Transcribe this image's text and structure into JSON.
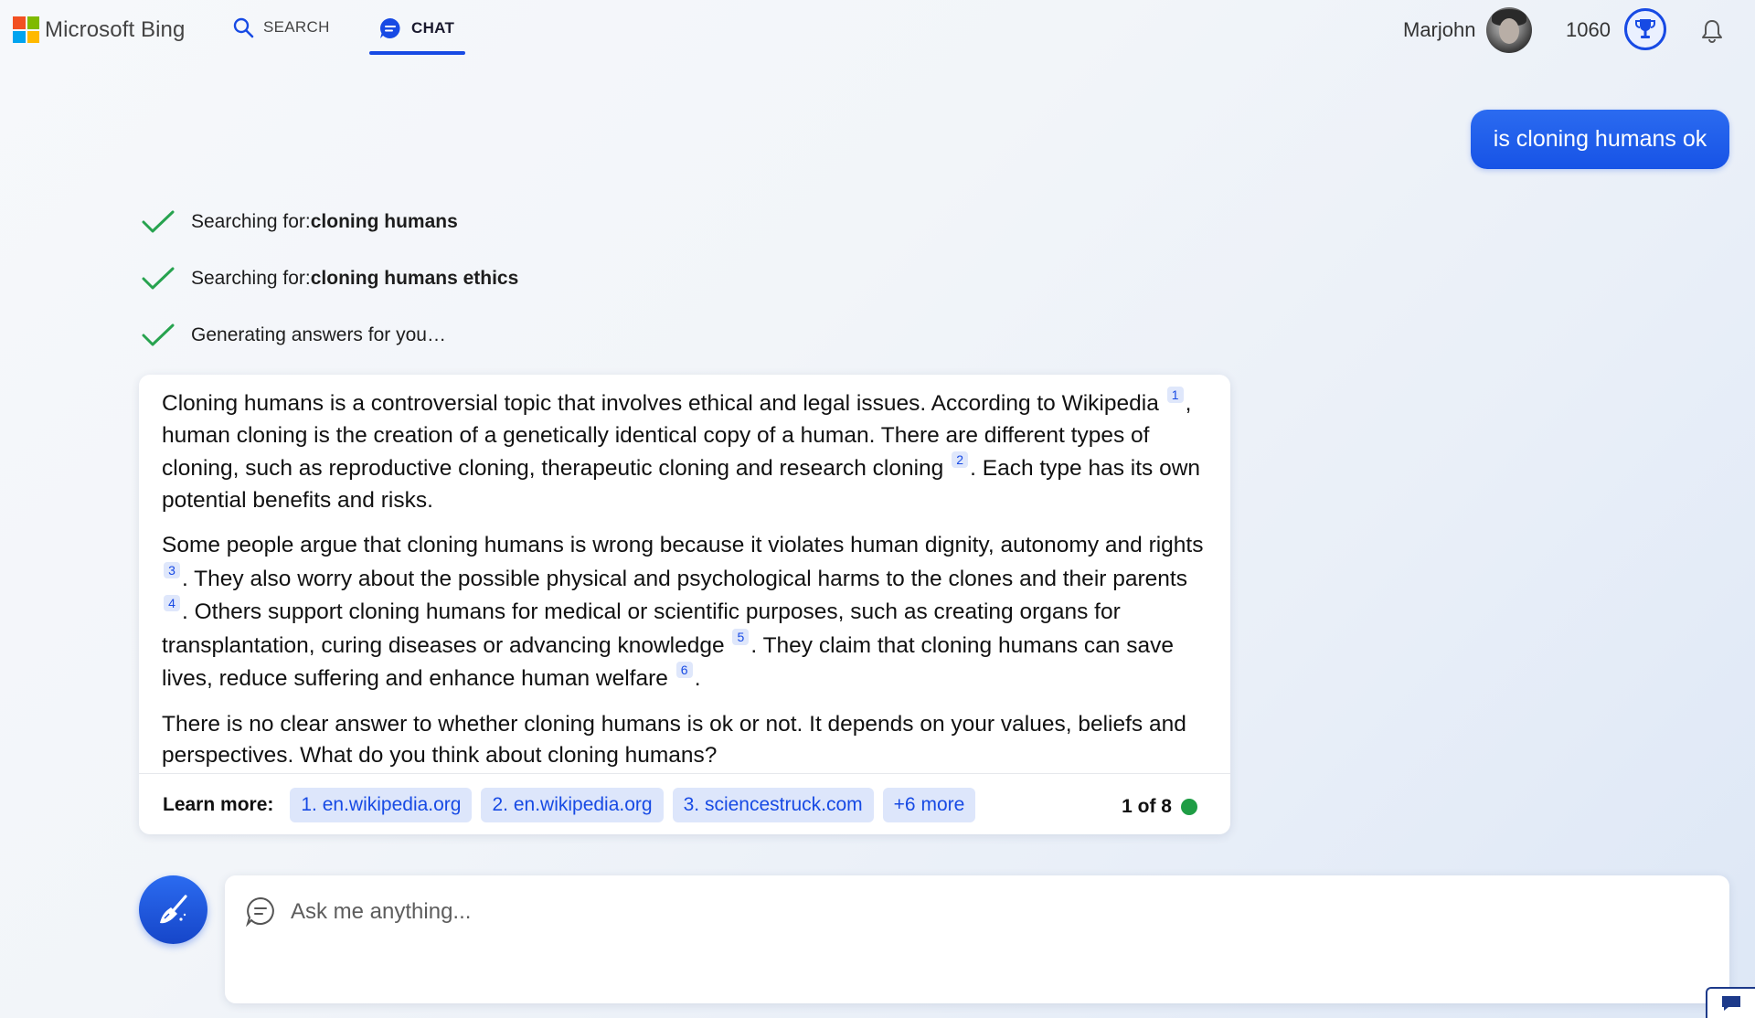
{
  "header": {
    "logo_text": "Microsoft Bing",
    "tabs": [
      {
        "label": "SEARCH",
        "icon": "search-icon",
        "active": false
      },
      {
        "label": "CHAT",
        "icon": "chat-bubble-icon",
        "active": true
      }
    ],
    "user_name": "Marjohn",
    "points": "1060",
    "accent_color": "#174ae4"
  },
  "conversation": {
    "user_message": "is cloning humans ok",
    "status_steps": [
      {
        "prefix": "Searching for: ",
        "query": "cloning humans"
      },
      {
        "prefix": "Searching for: ",
        "query": "cloning humans ethics"
      },
      {
        "prefix": "Generating answers for you…",
        "query": ""
      }
    ],
    "answer": {
      "p1": {
        "t1": "Cloning humans is a controversial topic that involves ethical and legal issues. According to Wikipedia ",
        "c1": "1",
        "t2": ", human cloning is the creation of a genetically identical copy of a human. There are different types of cloning, such as reproductive cloning, therapeutic cloning and research cloning ",
        "c2": "2",
        "t3": ". Each type has its own potential benefits and risks."
      },
      "p2": {
        "t1": "Some people argue that cloning humans is wrong because it violates human dignity, autonomy and rights ",
        "c1": "3",
        "t2": ". They also worry about the possible physical and psychological harms to the clones and their parents ",
        "c2": "4",
        "t3": ". Others support cloning humans for medical or scientific purposes, such as creating organs for transplantation, curing diseases or advancing knowledge ",
        "c3": "5",
        "t4": ". They claim that cloning humans can save lives, reduce suffering and enhance human welfare ",
        "c4": "6",
        "t5": "."
      },
      "p3": "There is no clear answer to whether cloning humans is ok or not. It depends on your values, beliefs and perspectives. What do you think about cloning humans?"
    },
    "learn_more": {
      "label": "Learn more:",
      "links": [
        "1. en.wikipedia.org",
        "2. en.wikipedia.org",
        "3. sciencestruck.com",
        "+6 more"
      ],
      "page_count": "1 of 8",
      "status_color": "#1f9d45"
    }
  },
  "composer": {
    "placeholder": "Ask me anything...",
    "new_topic_icon": "broom-icon"
  }
}
